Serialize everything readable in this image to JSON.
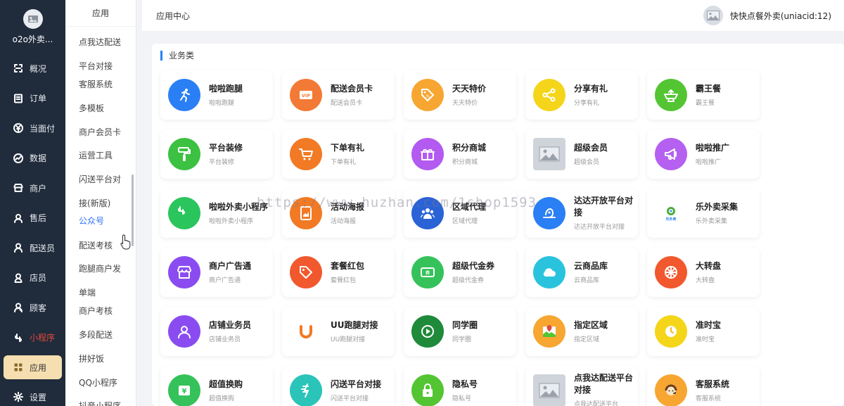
{
  "app": {
    "brand_name": "o2o外卖..."
  },
  "nav": [
    {
      "label": "概况",
      "icon": "overview-icon"
    },
    {
      "label": "订单",
      "icon": "order-icon"
    },
    {
      "label": "当面付",
      "icon": "yen-icon"
    },
    {
      "label": "数据",
      "icon": "chart-icon"
    },
    {
      "label": "商户",
      "icon": "shop-icon"
    },
    {
      "label": "售后",
      "icon": "after-sale-icon"
    },
    {
      "label": "配送员",
      "icon": "courier-icon"
    },
    {
      "label": "店员",
      "icon": "clerk-icon"
    },
    {
      "label": "顾客",
      "icon": "customer-icon"
    },
    {
      "label": "小程序",
      "icon": "miniprogram-icon"
    },
    {
      "label": "应用",
      "icon": "app-icon"
    },
    {
      "label": "设置",
      "icon": "gear-icon"
    }
  ],
  "submenu": {
    "title": "应用",
    "items": [
      "点我达配送",
      "平台对接",
      "客服系统",
      "多模板",
      "商户会员卡",
      "运营工具",
      "闪送平台对",
      "接(新版)",
      "公众号",
      "配送考核",
      "跑腿商户发",
      "单端",
      "商户考核",
      "多段配送",
      "拼好饭",
      "QQ小程序",
      "抖音小程序"
    ],
    "selected": "公众号"
  },
  "header": {
    "title": "应用中心",
    "account": "快快点餐外卖(uniacid:12)"
  },
  "section": {
    "title": "业务类"
  },
  "apps": [
    {
      "name": "啦啦跑腿",
      "desc": "啦啦跑腿",
      "icon": "runner-icon",
      "color": "#2a7ff4"
    },
    {
      "name": "配送会员卡",
      "desc": "配送会员卡",
      "icon": "vip-card-icon",
      "color": "#f27a36"
    },
    {
      "name": "天天特价",
      "desc": "天天特价",
      "icon": "discount-tag-icon",
      "color": "#f7a632"
    },
    {
      "name": "分享有礼",
      "desc": "分享有礼",
      "icon": "share-icon",
      "color": "#f4d51a"
    },
    {
      "name": "霸王餐",
      "desc": "霸王餐",
      "icon": "dish-icon",
      "color": "#53c533"
    },
    {
      "name": "平台装修",
      "desc": "平台装修",
      "icon": "paint-roller-icon",
      "color": "#3cc142"
    },
    {
      "name": "下单有礼",
      "desc": "下单有礼",
      "icon": "cart-icon",
      "color": "#f27a25"
    },
    {
      "name": "积分商城",
      "desc": "积分商城",
      "icon": "gift-icon",
      "color": "#b35af0"
    },
    {
      "name": "超级会员",
      "desc": "超级会员",
      "icon": "image-placeholder-icon",
      "color": "#cfd3da"
    },
    {
      "name": "啦啦推广",
      "desc": "啦啦推广",
      "icon": "megaphone-icon",
      "color": "#b560f0"
    },
    {
      "name": "啦啦外卖小程序",
      "desc": "啦啦外卖小程序",
      "icon": "miniprogram-icon",
      "color": "#2bc55d"
    },
    {
      "name": "活动海报",
      "desc": "活动海报",
      "icon": "poster-icon",
      "color": "#f27a25"
    },
    {
      "name": "区域代理",
      "desc": "区域代理",
      "icon": "agent-group-icon",
      "color": "#2a63d6"
    },
    {
      "name": "达达开放平台对接",
      "desc": "达达开放平台对接",
      "icon": "dada-icon",
      "color": "#2a7ff4"
    },
    {
      "name": "乐外卖采集",
      "desc": "乐外卖采集",
      "icon": "lewaimai-logo-icon",
      "color": "#ffffff"
    },
    {
      "name": "商户广告通",
      "desc": "商户广告通",
      "icon": "storefront-icon",
      "color": "#8a4cf0"
    },
    {
      "name": "套餐红包",
      "desc": "套餐红包",
      "icon": "red-packet-tag-icon",
      "color": "#f2582d"
    },
    {
      "name": "超级代金券",
      "desc": "超级代金券",
      "icon": "voucher-icon",
      "color": "#35c25a"
    },
    {
      "name": "云商品库",
      "desc": "云商品库",
      "icon": "cloud-icon",
      "color": "#29c3de"
    },
    {
      "name": "大转盘",
      "desc": "大转盘",
      "icon": "wheel-icon",
      "color": "#f2582d"
    },
    {
      "name": "店铺业务员",
      "desc": "店铺业务员",
      "icon": "user-icon",
      "color": "#8a4cf0"
    },
    {
      "name": "UU跑腿对接",
      "desc": "UU跑腿对接",
      "icon": "uu-logo-icon",
      "color": "#ffffff"
    },
    {
      "name": "同学圈",
      "desc": "同学圈",
      "icon": "play-circle-icon",
      "color": "#1f8a3a"
    },
    {
      "name": "指定区域",
      "desc": "指定区域",
      "icon": "map-pin-icon",
      "color": "#f7a632"
    },
    {
      "name": "准时宝",
      "desc": "准时宝",
      "icon": "clock-icon",
      "color": "#f4d51a"
    },
    {
      "name": "超值换购",
      "desc": "超值换购",
      "icon": "yen-bag-icon",
      "color": "#35c25a"
    },
    {
      "name": "闪送平台对接",
      "desc": "闪送平台对接",
      "icon": "flash-icon",
      "color": "#2ac4b8"
    },
    {
      "name": "隐私号",
      "desc": "隐私号",
      "icon": "lock-icon",
      "color": "#53c533"
    },
    {
      "name": "点我达配送平台对接",
      "desc": "点我达配送平台",
      "icon": "image-placeholder-icon",
      "color": "#cfd3da"
    },
    {
      "name": "客服系统",
      "desc": "客服系统",
      "icon": "support-agent-icon",
      "color": "#f7a632"
    }
  ],
  "watermark": "https://www.huzhan.com/1shop1593"
}
